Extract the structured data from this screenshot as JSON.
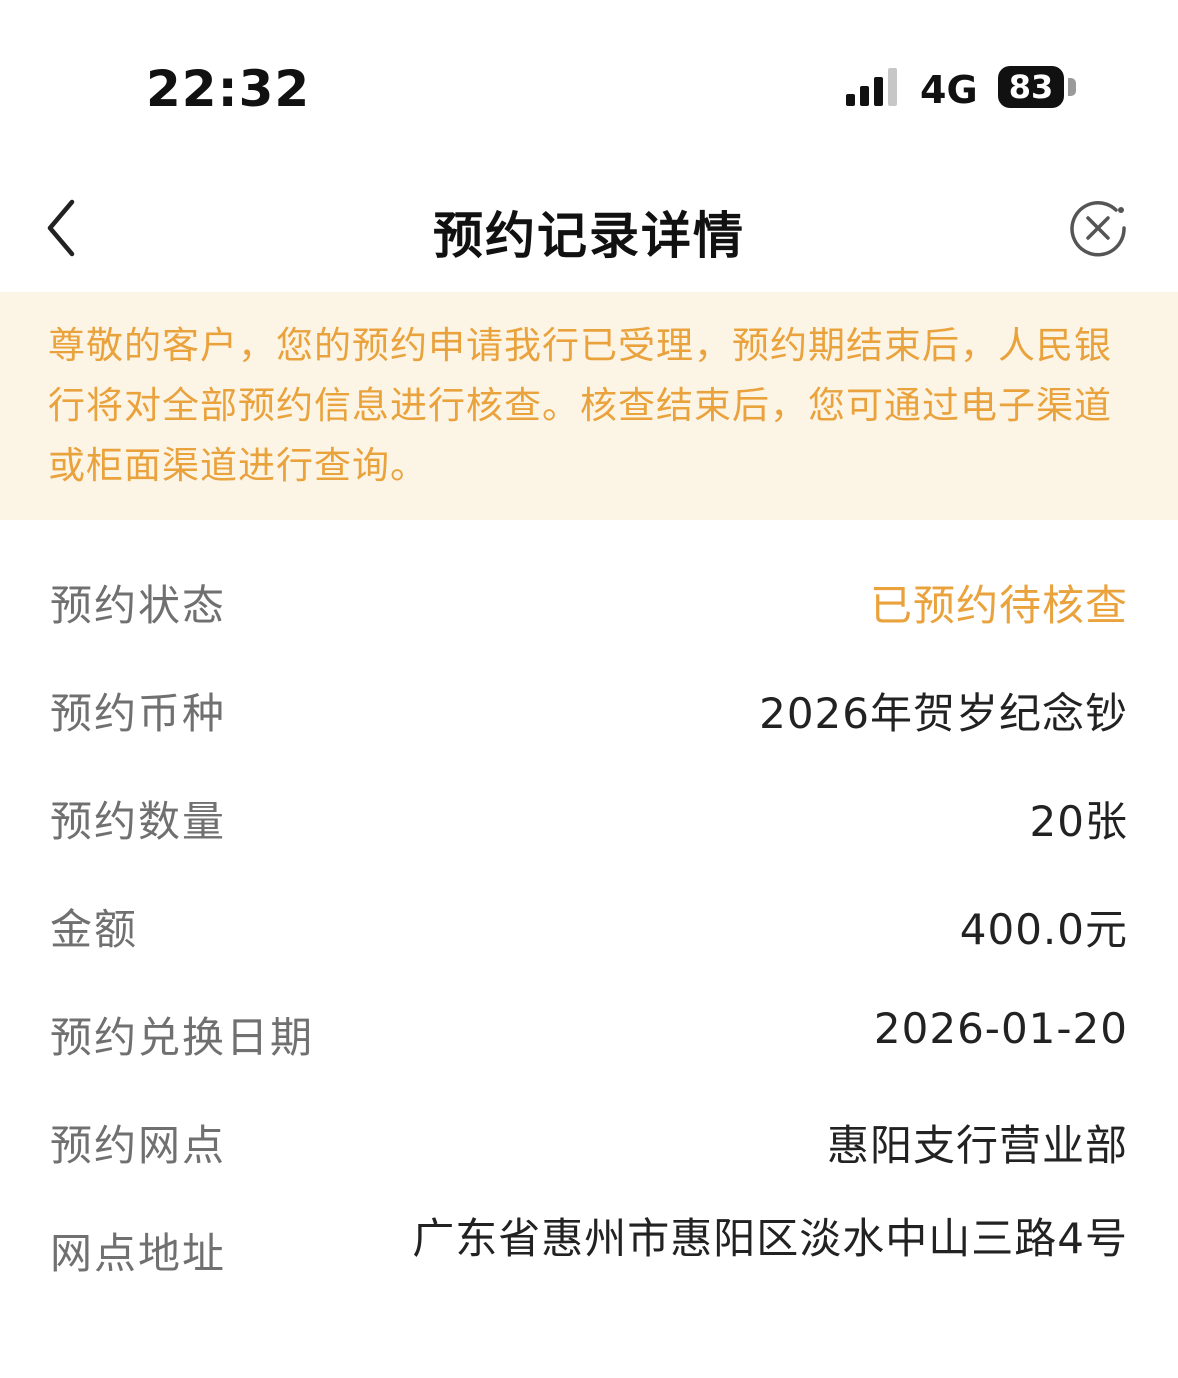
{
  "status_bar": {
    "time": "22:32",
    "network": "4G",
    "battery": "83",
    "signal_icon": "signal-bars-icon",
    "battery_icon": "battery-icon"
  },
  "nav": {
    "title": "预约记录详情",
    "back_icon": "chevron-left-icon",
    "close_icon": "close-circle-icon"
  },
  "notice": {
    "text": "尊敬的客户，您的预约申请我行已受理，预约期结束后，人民银行将对全部预约信息进行核查。核查结束后，您可通过电子渠道或柜面渠道进行查询。"
  },
  "details": [
    {
      "label": "预约状态",
      "value": "已预约待核查"
    },
    {
      "label": "预约币种",
      "value": "2026年贺岁纪念钞"
    },
    {
      "label": "预约数量",
      "value": "20张"
    },
    {
      "label": "金额",
      "value": "400.0元"
    },
    {
      "label": "预约兑换日期",
      "value": "2026-01-20"
    },
    {
      "label": "预约网点",
      "value": "惠阳支行营业部"
    },
    {
      "label": "网点地址",
      "value": "广东省惠州市惠阳区淡水中山三路4号"
    }
  ],
  "colors": {
    "accent": "#eaa23d",
    "notice_bg": "#fcf5e6",
    "label": "#707070",
    "value": "#222222"
  }
}
